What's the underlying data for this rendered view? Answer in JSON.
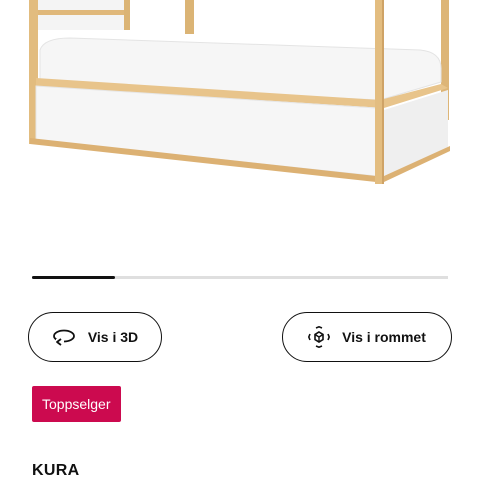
{
  "gallery": {
    "current_index": 1,
    "total_images": 5,
    "progress": 0.2
  },
  "actions": {
    "view_3d_label": "Vis i 3D",
    "view_3d_icon": "rotate-3d-icon",
    "view_room_label": "Vis i rommet",
    "view_room_icon": "augmented-reality-icon"
  },
  "badge": {
    "label": "Toppselger",
    "color": "#cc0a4f"
  },
  "product": {
    "name": "KURA"
  }
}
